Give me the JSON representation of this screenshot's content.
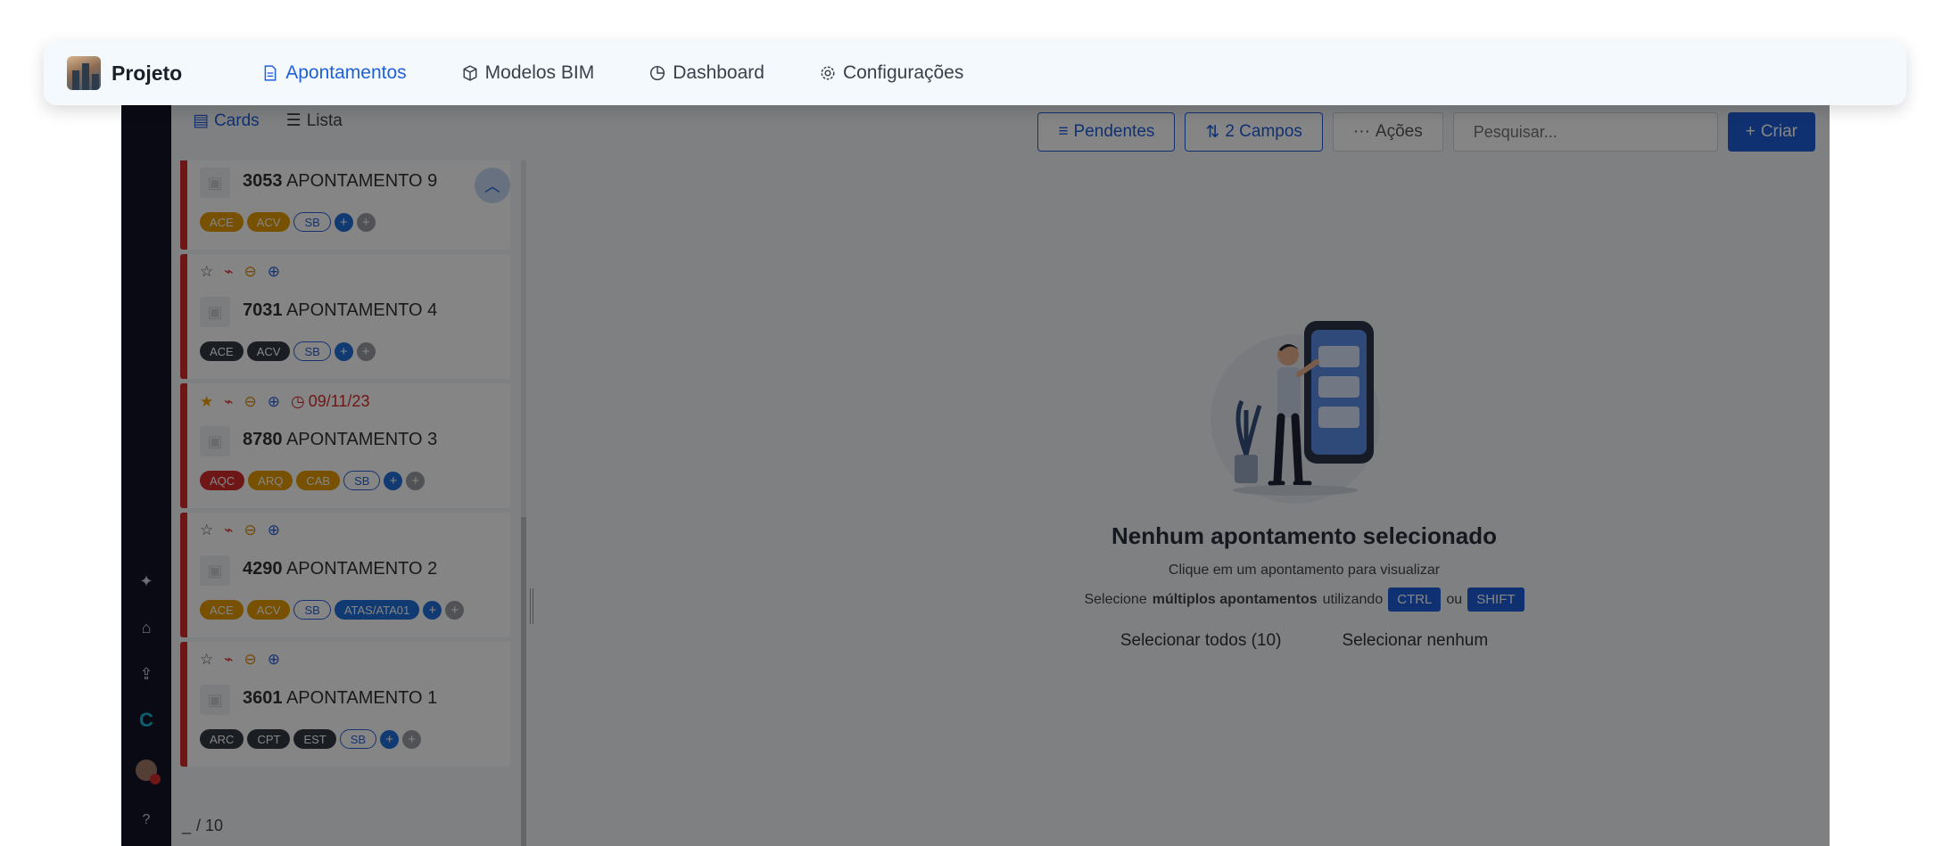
{
  "nav": {
    "project_name": "Projeto",
    "tabs": [
      {
        "label": "Apontamentos",
        "icon": "document-icon",
        "active": true
      },
      {
        "label": "Modelos BIM",
        "icon": "cube-icon",
        "active": false
      },
      {
        "label": "Dashboard",
        "icon": "pie-chart-icon",
        "active": false
      },
      {
        "label": "Configurações",
        "icon": "gear-icon",
        "active": false
      }
    ]
  },
  "toolbar": {
    "view_cards": "Cards",
    "view_list": "Lista",
    "filter_label": "Pendentes",
    "sort_label": "2 Campos",
    "actions_label": "Ações",
    "search_placeholder": "Pesquisar...",
    "create_label": "Criar"
  },
  "cards": [
    {
      "id": "3053",
      "title": "APONTAMENTO 9",
      "favorite": false,
      "due": "",
      "tags": [
        {
          "label": "ACE",
          "kind": "orange"
        },
        {
          "label": "ACV",
          "kind": "orange"
        },
        {
          "label": "SB",
          "kind": "sb"
        }
      ]
    },
    {
      "id": "7031",
      "title": "APONTAMENTO 4",
      "favorite": false,
      "due": "",
      "tags": [
        {
          "label": "ACE",
          "kind": "dark"
        },
        {
          "label": "ACV",
          "kind": "dark"
        },
        {
          "label": "SB",
          "kind": "sb"
        }
      ]
    },
    {
      "id": "8780",
      "title": "APONTAMENTO 3",
      "favorite": true,
      "due": "09/11/23",
      "tags": [
        {
          "label": "AQC",
          "kind": "red"
        },
        {
          "label": "ARQ",
          "kind": "orange"
        },
        {
          "label": "CAB",
          "kind": "orange"
        },
        {
          "label": "SB",
          "kind": "sb"
        }
      ]
    },
    {
      "id": "4290",
      "title": "APONTAMENTO 2",
      "favorite": false,
      "due": "",
      "tags": [
        {
          "label": "ACE",
          "kind": "orange"
        },
        {
          "label": "ACV",
          "kind": "orange"
        },
        {
          "label": "SB",
          "kind": "sb"
        },
        {
          "label": "ATAS/ATA01",
          "kind": "blue"
        }
      ]
    },
    {
      "id": "3601",
      "title": "APONTAMENTO 1",
      "favorite": false,
      "due": "",
      "tags": [
        {
          "label": "ARC",
          "kind": "dark"
        },
        {
          "label": "CPT",
          "kind": "dark"
        },
        {
          "label": "EST",
          "kind": "dark"
        },
        {
          "label": "SB",
          "kind": "sb"
        }
      ]
    }
  ],
  "pager": {
    "current": "_",
    "total": "/ 10"
  },
  "empty_state": {
    "title": "Nenhum apontamento selecionado",
    "hint": "Clique em um apontamento para visualizar",
    "multi_prefix": "Selecione",
    "multi_bold": "múltiplos apontamentos",
    "multi_suffix": "utilizando",
    "key_ctrl": "CTRL",
    "or": "ou",
    "key_shift": "SHIFT",
    "select_all": "Selecionar todos (10)",
    "select_none": "Selecionar nenhum"
  },
  "colors": {
    "accent": "#1f5fd9",
    "card_border": "#d52b2b",
    "rail": "#15152a"
  }
}
